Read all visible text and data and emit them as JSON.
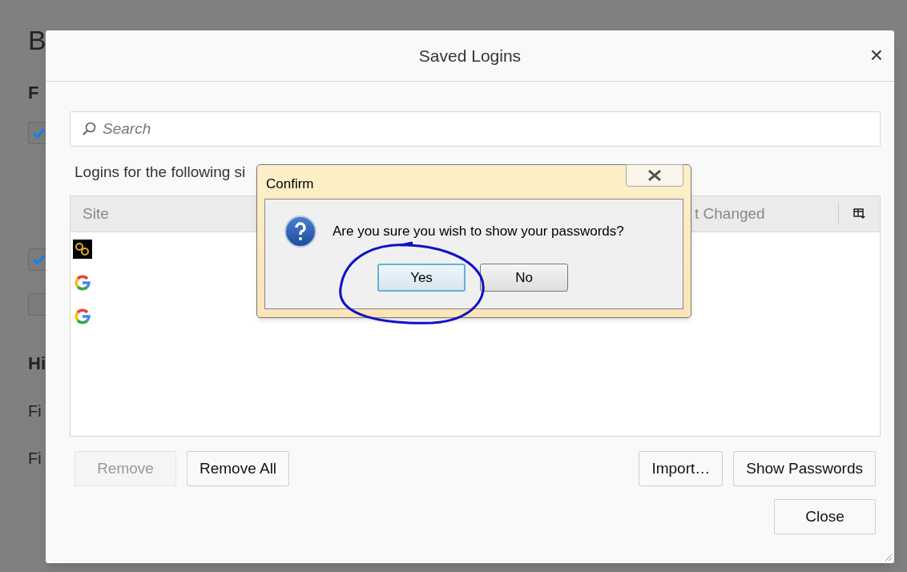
{
  "background_page": {
    "title": "B",
    "sections": [
      {
        "heading": "F",
        "checkbox_rows": [
          {
            "checked": true
          },
          {
            "checked": true
          },
          {
            "checked": false
          }
        ]
      },
      {
        "heading": "Hi",
        "lines": [
          "Fi",
          "Fi"
        ]
      }
    ]
  },
  "dialog": {
    "title": "Saved Logins",
    "close": "×",
    "search": {
      "placeholder": "Search"
    },
    "description": "Logins for the following si",
    "table": {
      "columns": [
        "Site",
        "t Changed"
      ],
      "rows": [
        {
          "kind": "chain"
        },
        {
          "kind": "g"
        },
        {
          "kind": "g"
        }
      ]
    },
    "buttons_left": [
      {
        "label": "Remove",
        "disabled": true
      },
      {
        "label": "Remove All",
        "disabled": false
      }
    ],
    "buttons_right": [
      {
        "label": "Import…",
        "disabled": false
      },
      {
        "label": "Show Passwords",
        "disabled": false
      }
    ],
    "close_button": {
      "label": "Close"
    }
  },
  "confirm": {
    "title": "Confirm",
    "message": "Are you sure you wish to show your passwords?",
    "buttons": [
      {
        "label": "Yes",
        "focused": true
      },
      {
        "label": "No",
        "focused": false
      }
    ]
  }
}
